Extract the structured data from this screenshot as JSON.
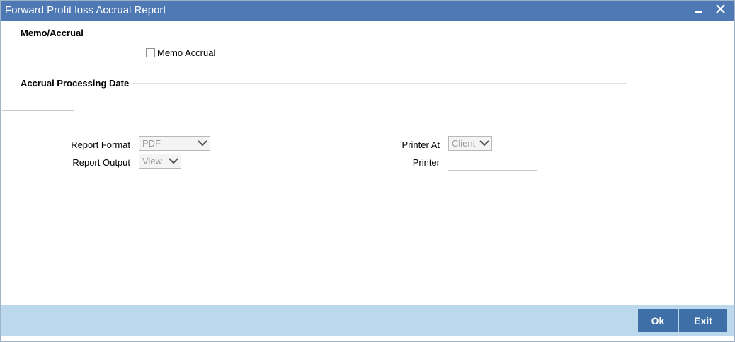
{
  "window": {
    "title": "Forward Profit loss Accrual Report",
    "minimize_icon": "minimize-icon",
    "close_icon": "close-icon"
  },
  "sections": {
    "memo_accrual": "Memo/Accrual",
    "accrual_processing_date": "Accrual Processing Date"
  },
  "memo_accrual_checkbox": {
    "label": "Memo Accrual",
    "checked": false
  },
  "report": {
    "format_label": "Report Format",
    "format_value": "PDF",
    "output_label": "Report Output",
    "output_value": "View",
    "printer_at_label": "Printer At",
    "printer_at_value": "Client",
    "printer_label": "Printer",
    "printer_value": ""
  },
  "footer": {
    "ok_label": "Ok",
    "exit_label": "Exit"
  },
  "colors": {
    "titlebar": "#4e79b4",
    "footer": "#bcd8ec",
    "button": "#3e6fa6"
  }
}
